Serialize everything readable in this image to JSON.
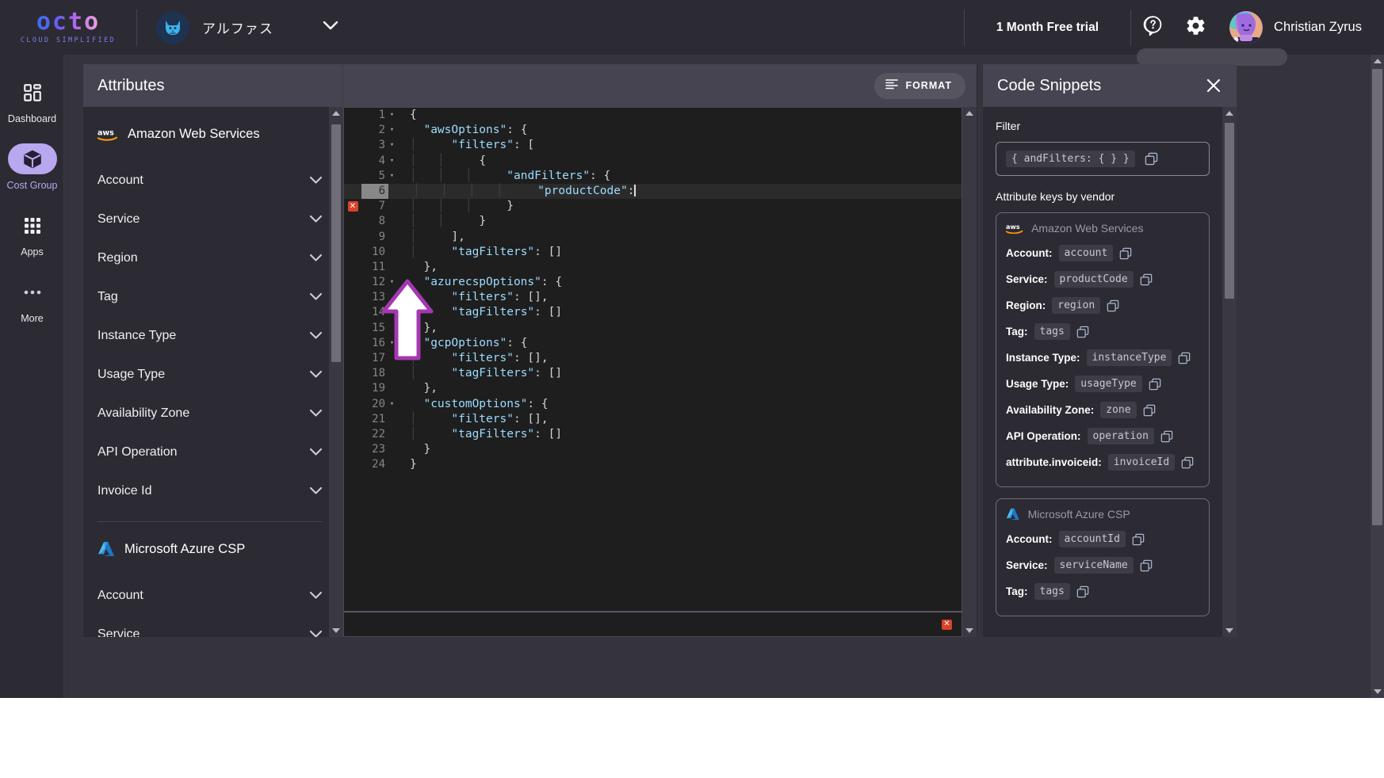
{
  "topbar": {
    "logo_text": "octo",
    "logo_tagline": "CLOUD SIMPLIFIED",
    "org_name": "アルファス",
    "org_avatar_icon": "cat-avatar-icon",
    "org_caret_icon": "chevron-down-icon",
    "trial_label": "1 Month Free trial",
    "help_icon": "help-circle-icon",
    "settings_icon": "gear-icon",
    "user_name": "Christian Zyrus",
    "user_avatar_icon": "user-avatar"
  },
  "leftnav": {
    "items": [
      {
        "label": "Dashboard",
        "icon": "dashboard-grid-icon",
        "active": false
      },
      {
        "label": "Cost Group",
        "icon": "cube-box-icon",
        "active": true
      },
      {
        "label": "Apps",
        "icon": "apps-grid-icon",
        "active": false
      },
      {
        "label": "More",
        "icon": "ellipsis-icon",
        "active": false
      }
    ]
  },
  "attributes": {
    "title": "Attributes",
    "groups": [
      {
        "vendor": "Amazon Web Services",
        "vendor_icon": "aws-logo-icon",
        "rows": [
          {
            "label": "Account",
            "chevron": true
          },
          {
            "label": "Service",
            "chevron": true
          },
          {
            "label": "Region",
            "chevron": true
          },
          {
            "label": "Tag",
            "chevron": true
          },
          {
            "label": "Instance Type",
            "chevron": true
          },
          {
            "label": "Usage Type",
            "chevron": true
          },
          {
            "label": "Availability Zone",
            "chevron": true
          },
          {
            "label": "API Operation",
            "chevron": true
          },
          {
            "label": "Invoice Id",
            "chevron": true
          }
        ]
      },
      {
        "vendor": "Microsoft Azure CSP",
        "vendor_icon": "azure-logo-icon",
        "rows": [
          {
            "label": "Account",
            "chevron": true
          },
          {
            "label": "Service",
            "chevron": true
          }
        ]
      }
    ]
  },
  "editor": {
    "format_button": "FORMAT",
    "format_icon": "format-lines-icon",
    "error_icon": "error-x-icon",
    "current_line": 6,
    "error_lines": [
      7
    ],
    "lines": [
      {
        "n": 1,
        "fold": true,
        "indent": 0,
        "text": "{"
      },
      {
        "n": 2,
        "fold": true,
        "indent": 0,
        "text": "  \"awsOptions\": {"
      },
      {
        "n": 3,
        "fold": true,
        "indent": 1,
        "text": "  \"filters\": ["
      },
      {
        "n": 4,
        "fold": true,
        "indent": 2,
        "text": "  {"
      },
      {
        "n": 5,
        "fold": true,
        "indent": 3,
        "text": "  \"andFilters\": {"
      },
      {
        "n": 6,
        "fold": false,
        "indent": 4,
        "text": "  \"productCode\":"
      },
      {
        "n": 7,
        "fold": false,
        "indent": 3,
        "text": "  }"
      },
      {
        "n": 8,
        "fold": false,
        "indent": 2,
        "text": "  }"
      },
      {
        "n": 9,
        "fold": false,
        "indent": 1,
        "text": "  ],"
      },
      {
        "n": 10,
        "fold": false,
        "indent": 1,
        "text": "  \"tagFilters\": []"
      },
      {
        "n": 11,
        "fold": false,
        "indent": 0,
        "text": "  },"
      },
      {
        "n": 12,
        "fold": true,
        "indent": 0,
        "text": "  \"azurecspOptions\": {"
      },
      {
        "n": 13,
        "fold": false,
        "indent": 1,
        "text": "  \"filters\": [],"
      },
      {
        "n": 14,
        "fold": false,
        "indent": 1,
        "text": "  \"tagFilters\": []"
      },
      {
        "n": 15,
        "fold": false,
        "indent": 0,
        "text": "  },"
      },
      {
        "n": 16,
        "fold": true,
        "indent": 0,
        "text": "  \"gcpOptions\": {"
      },
      {
        "n": 17,
        "fold": false,
        "indent": 1,
        "text": "  \"filters\": [],"
      },
      {
        "n": 18,
        "fold": false,
        "indent": 1,
        "text": "  \"tagFilters\": []"
      },
      {
        "n": 19,
        "fold": false,
        "indent": 0,
        "text": "  },"
      },
      {
        "n": 20,
        "fold": true,
        "indent": 0,
        "text": "  \"customOptions\": {"
      },
      {
        "n": 21,
        "fold": false,
        "indent": 1,
        "text": "  \"filters\": [],"
      },
      {
        "n": 22,
        "fold": false,
        "indent": 1,
        "text": "  \"tagFilters\": []"
      },
      {
        "n": 23,
        "fold": false,
        "indent": 0,
        "text": "  }"
      },
      {
        "n": 24,
        "fold": false,
        "indent": 0,
        "text": "}"
      }
    ]
  },
  "snippets": {
    "title": "Code Snippets",
    "close_icon": "close-icon",
    "filter_label": "Filter",
    "filter_snippet": "{ andFilters: { } }",
    "copy_icon": "copy-icon",
    "vendor_section_label": "Attribute keys by vendor",
    "vendors": [
      {
        "name": "Amazon Web Services",
        "icon": "aws-logo-icon",
        "keys": [
          {
            "label": "Account:",
            "value": "account"
          },
          {
            "label": "Service:",
            "value": "productCode"
          },
          {
            "label": "Region:",
            "value": "region"
          },
          {
            "label": "Tag:",
            "value": "tags"
          },
          {
            "label": "Instance Type:",
            "value": "instanceType"
          },
          {
            "label": "Usage Type:",
            "value": "usageType"
          },
          {
            "label": "Availability Zone:",
            "value": "zone"
          },
          {
            "label": "API Operation:",
            "value": "operation"
          },
          {
            "label": "attribute.invoiceid:",
            "value": "invoiceId"
          }
        ]
      },
      {
        "name": "Microsoft Azure CSP",
        "icon": "azure-logo-icon",
        "keys": [
          {
            "label": "Account:",
            "value": "accountId"
          },
          {
            "label": "Service:",
            "value": "serviceName"
          },
          {
            "label": "Tag:",
            "value": "tags"
          }
        ]
      }
    ]
  },
  "colors": {
    "accent": "#b9a7f0",
    "topbar_bg": "#2c2a33",
    "panel_bg": "#2c2a33",
    "header_bg": "#464450",
    "editor_bg": "#1e1e1e",
    "error_red": "#d9422b",
    "aws_orange": "#ff9900",
    "azure_blue": "#2e9ad6",
    "arrow_outline": "#a438b0"
  }
}
